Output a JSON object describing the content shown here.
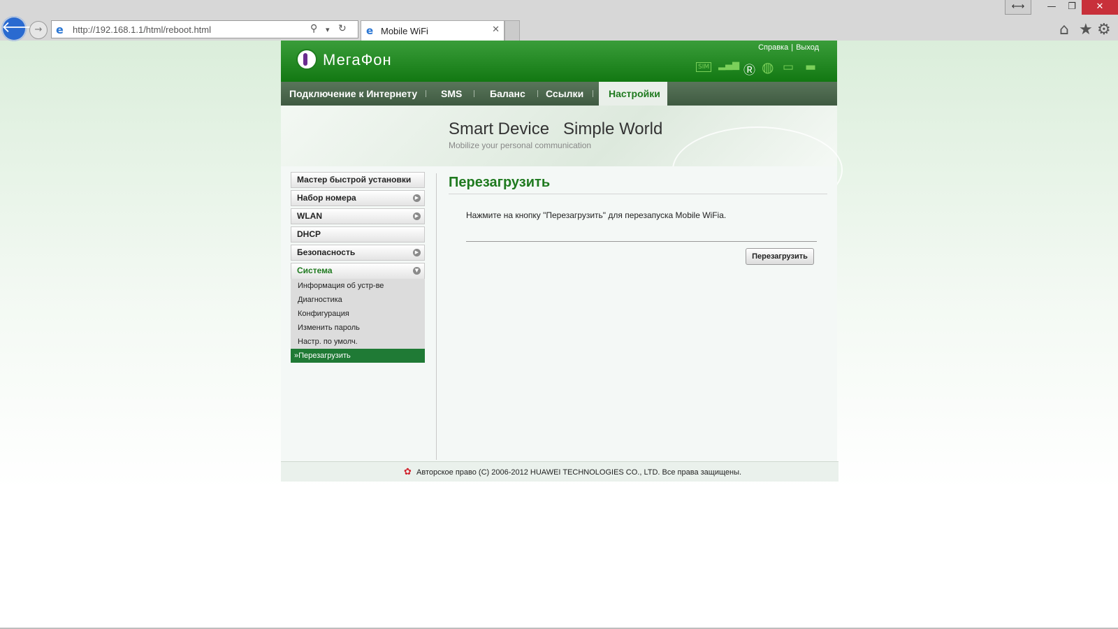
{
  "browser": {
    "window_buttons": {
      "snap": "⟷",
      "minimize": "—",
      "maximize": "❐",
      "close": "✕"
    },
    "back_icon": "🡐",
    "forward_icon": "→",
    "address_bar": {
      "url": "http://192.168.1.1/html/reboot.html",
      "search_icon": "⚲",
      "dropdown_icon": "▾",
      "refresh_icon": "↻"
    },
    "tab": {
      "title": "Mobile WiFi",
      "close": "✕"
    },
    "toolbar": {
      "home_icon": "⌂",
      "favorites_icon": "★",
      "tools_icon": "⚙"
    }
  },
  "header": {
    "logo_text": "МегаФон",
    "links": [
      "Справка",
      "Выход"
    ],
    "status_icons": [
      "sim-icon",
      "signal-icon",
      "roaming-icon",
      "internet-icon",
      "wifi-icon",
      "battery-icon"
    ],
    "status_icon_glyphs": {
      "sim": "▭",
      "signal": "▂▄▆",
      "roaming": "Ⓡ",
      "internet": "◍",
      "wifi": "▭",
      "battery": "▬"
    }
  },
  "menu": {
    "items": [
      "Подключение к Интернету",
      "SMS",
      "Баланс",
      "Ссылки",
      "Настройки"
    ],
    "active": "Настройки"
  },
  "banner": {
    "slogan": "Smart Device   Simple World",
    "subtitle": "Mobilize your personal communication"
  },
  "sidebar": {
    "items": [
      {
        "label": "Мастер быстрой установки",
        "has_arrow": false
      },
      {
        "label": "Набор номера",
        "has_arrow": true
      },
      {
        "label": "WLAN",
        "has_arrow": true
      },
      {
        "label": "DHCP",
        "has_arrow": false
      },
      {
        "label": "Безопасность",
        "has_arrow": true
      },
      {
        "label": "Система",
        "has_arrow": true,
        "open": true
      }
    ],
    "arrow_glyph": "▶",
    "open_arrow_glyph": "▼",
    "subitems": [
      "Информация об устр-ве",
      "Диагностика",
      "Конфигурация",
      "Изменить пароль",
      "Настр. по умолч.",
      "»Перезагрузить"
    ],
    "active_subitem": "»Перезагрузить"
  },
  "main": {
    "title": "Перезагрузить",
    "message": "Нажмите на кнопку \"Перезагрузить\" для перезапуска Mobile WiFia.",
    "button_label": "Перезагрузить"
  },
  "footer": {
    "copyright": "Авторское право (C) 2006-2012 HUAWEI TECHNOLOGIES CO., LTD. Все права защищены.",
    "logo_glyph": "✿"
  },
  "colors": {
    "brand_green": "#1f7a1f",
    "active_green": "#1f7a35",
    "menu_bg": "#4b674d"
  }
}
